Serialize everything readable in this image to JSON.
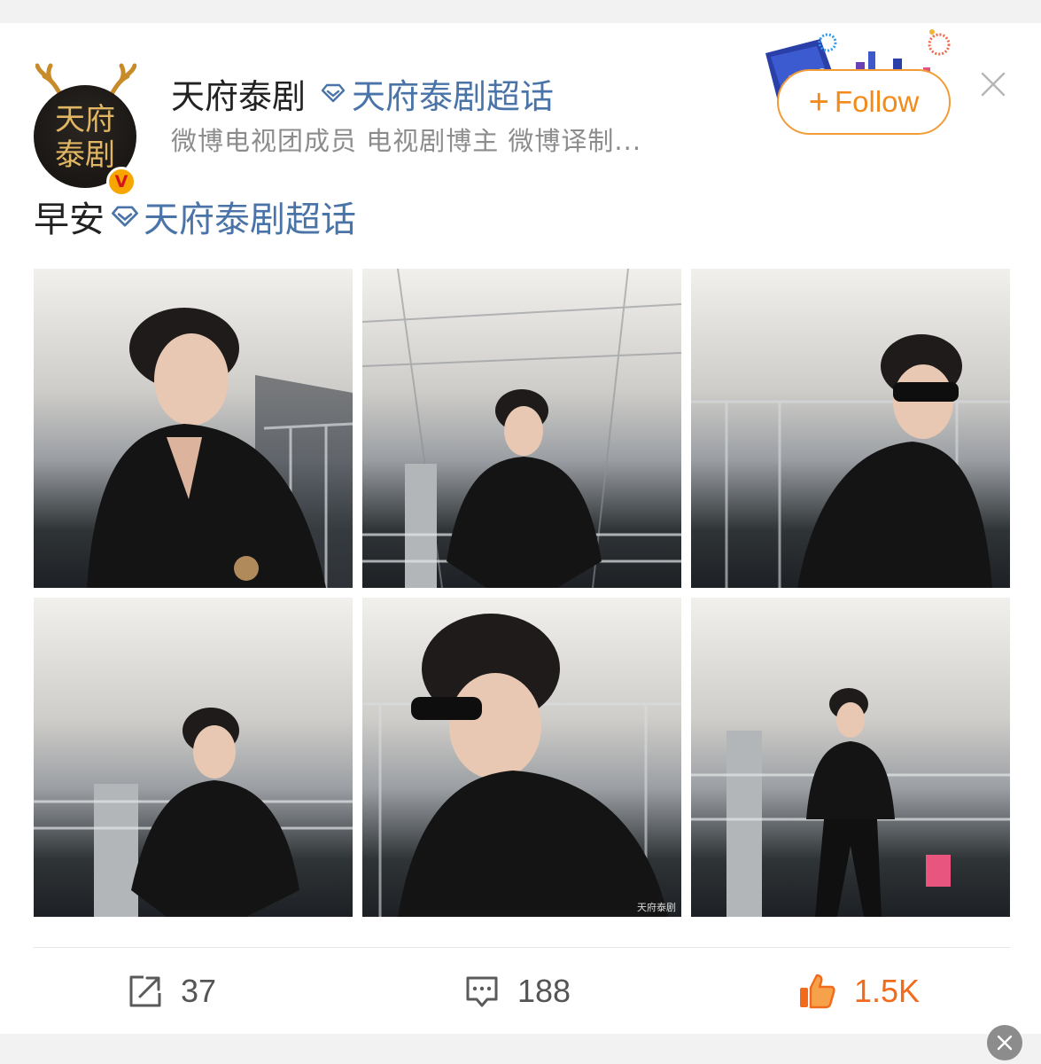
{
  "post": {
    "author": {
      "name": "天府泰剧",
      "avatar_text": [
        "天府",
        "泰剧"
      ],
      "verified_badge": "V",
      "topic_tag": "天府泰剧超话",
      "subtitle": "微博电视团成员 电视剧博主 微博译制..."
    },
    "follow_button": {
      "plus": "+",
      "label": "Follow"
    },
    "content": {
      "text": "早安",
      "topic": "天府泰剧超话"
    },
    "photos": [
      {
        "alt": "man in black shirt at airport, looking right, wristwatch"
      },
      {
        "alt": "man in black shirt leaning on railing, airport terminal"
      },
      {
        "alt": "man in sunglasses and black shirt leaning on railing"
      },
      {
        "alt": "man in black shirt leaning on railing under curved roof"
      },
      {
        "alt": "man in sunglasses, side profile, close-up",
        "watermark": "天府泰剧"
      },
      {
        "alt": "full-body man in black outfit standing by railing"
      }
    ],
    "actions": {
      "repost_count": "37",
      "comment_count": "188",
      "like_count": "1.5K"
    }
  },
  "colors": {
    "link_blue": "#4a74a8",
    "follow_orange": "#f28a1c",
    "like_orange": "#f26b1d",
    "badge_gold": "#f7a600"
  },
  "icons": [
    "diamond-icon",
    "plus-icon",
    "close-icon",
    "repost-icon",
    "comment-icon",
    "like-icon"
  ]
}
